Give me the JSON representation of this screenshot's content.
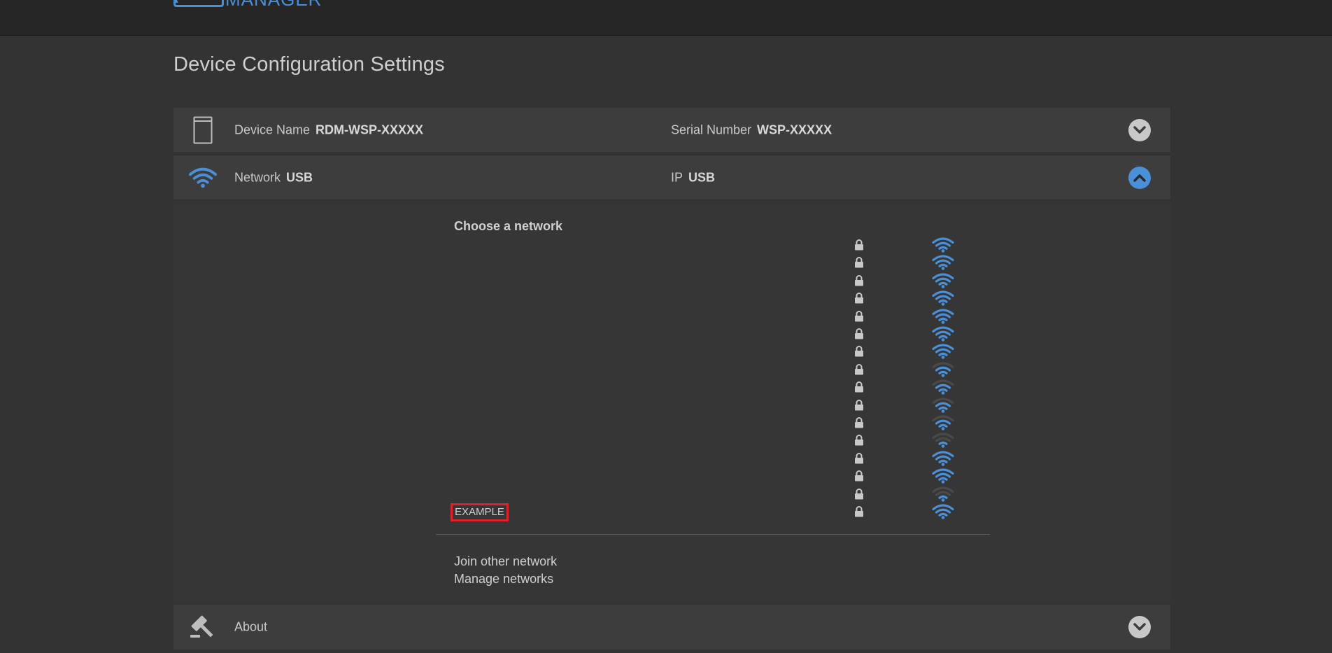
{
  "header": {
    "logo_text": "MANAGER"
  },
  "page_title": "Device Configuration Settings",
  "device_row": {
    "name_label": "Device Name",
    "name_value": "RDM-WSP-XXXXX",
    "serial_label": "Serial Number",
    "serial_value": "WSP-XXXXX"
  },
  "network_row": {
    "network_label": "Network",
    "network_value": "USB",
    "ip_label": "IP",
    "ip_value": "USB"
  },
  "network_panel": {
    "title": "Choose a network",
    "networks": [
      {
        "name": "",
        "locked": true,
        "signal": 4
      },
      {
        "name": "",
        "locked": true,
        "signal": 4
      },
      {
        "name": "",
        "locked": true,
        "signal": 4
      },
      {
        "name": "",
        "locked": true,
        "signal": 4
      },
      {
        "name": "",
        "locked": true,
        "signal": 4
      },
      {
        "name": "",
        "locked": true,
        "signal": 4
      },
      {
        "name": "",
        "locked": true,
        "signal": 4
      },
      {
        "name": "",
        "locked": true,
        "signal": 3
      },
      {
        "name": "",
        "locked": true,
        "signal": 3
      },
      {
        "name": "",
        "locked": true,
        "signal": 3
      },
      {
        "name": "",
        "locked": true,
        "signal": 3
      },
      {
        "name": "",
        "locked": true,
        "signal": 2
      },
      {
        "name": "",
        "locked": true,
        "signal": 4
      },
      {
        "name": "",
        "locked": true,
        "signal": 4
      },
      {
        "name": "",
        "locked": true,
        "signal": 2
      },
      {
        "name": "EXAMPLE",
        "locked": true,
        "signal": 4
      }
    ],
    "join_other": "Join other network",
    "manage": "Manage networks"
  },
  "about_row": {
    "label": "About"
  },
  "colors": {
    "accent": "#4a90d9",
    "dim_wave": "#4a4a4a",
    "highlight": "#e0202a"
  }
}
